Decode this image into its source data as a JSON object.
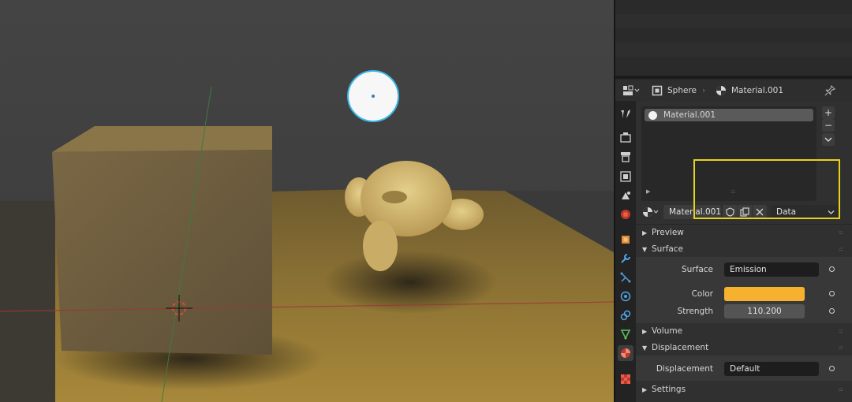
{
  "viewport": {
    "label": "3D viewport rendered view"
  },
  "properties": {
    "breadcrumb": {
      "object": "Sphere",
      "material": "Material.001"
    },
    "material_slots": [
      "Material.001"
    ],
    "material_selector": {
      "name": "Material.001",
      "link": "Data"
    },
    "sections": {
      "preview": "Preview",
      "surface": "Surface",
      "volume": "Volume",
      "displacement": "Displacement",
      "settings": "Settings"
    },
    "surface": {
      "surface_label": "Surface",
      "surface_value": "Emission",
      "color_label": "Color",
      "color_value": "#f6b22f",
      "strength_label": "Strength",
      "strength_value": "110.200"
    },
    "displacement": {
      "displacement_label": "Displacement",
      "displacement_value": "Default"
    },
    "side_buttons": {
      "add": "+",
      "remove": "−"
    }
  },
  "icons": [
    "editor-type-icon",
    "object-icon",
    "material-icon",
    "pin-icon",
    "tool-tab-icon",
    "render-tab-icon",
    "output-tab-icon",
    "view-layer-tab-icon",
    "scene-tab-icon",
    "world-tab-icon",
    "object-tab-icon",
    "modifier-tab-icon",
    "particles-tab-icon",
    "physics-tab-icon",
    "constraints-tab-icon",
    "data-tab-icon",
    "material-tab-icon",
    "texture-tab-icon",
    "shield-icon",
    "duplicate-icon",
    "close-icon"
  ]
}
